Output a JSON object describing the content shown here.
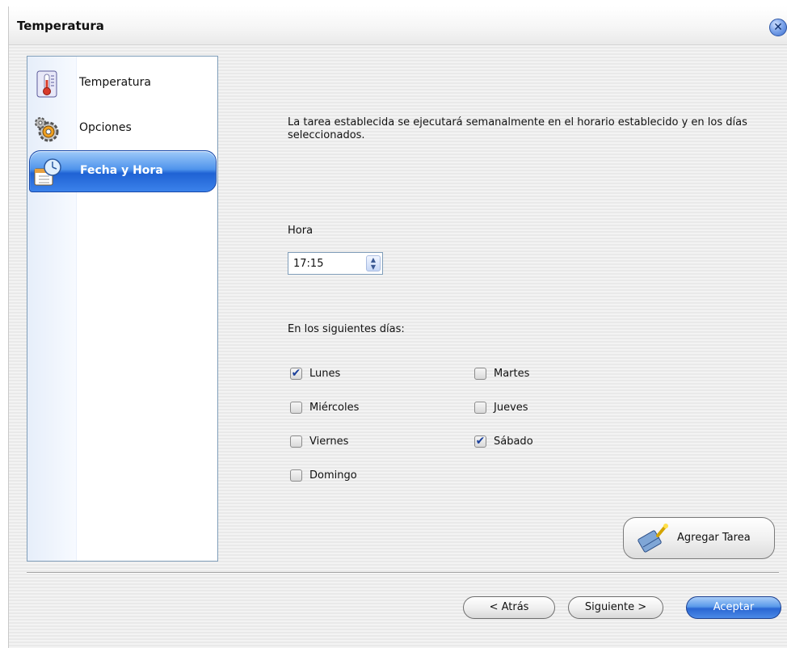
{
  "window": {
    "title": "Temperatura",
    "close_icon": "close-icon"
  },
  "sidebar": {
    "items": [
      {
        "label": "Temperatura",
        "icon": "thermometer-icon",
        "active": false
      },
      {
        "label": "Opciones",
        "icon": "gears-icon",
        "active": false
      },
      {
        "label": "Fecha y Hora",
        "icon": "calendar-clock-icon",
        "active": true
      }
    ]
  },
  "main": {
    "description": "La tarea establecida se ejecutará semanalmente en el horario establecido y en los días seleccionados.",
    "hora_label": "Hora",
    "time_value": "17:15",
    "days_label": "En los siguientes días:",
    "days": [
      {
        "label": "Lunes",
        "checked": true
      },
      {
        "label": "Martes",
        "checked": false
      },
      {
        "label": "Miércoles",
        "checked": false
      },
      {
        "label": "Jueves",
        "checked": false
      },
      {
        "label": "Viernes",
        "checked": false
      },
      {
        "label": "Sábado",
        "checked": true
      },
      {
        "label": "Domingo",
        "checked": false
      }
    ],
    "add_task_label": "Agregar Tarea"
  },
  "footer": {
    "back_label": "< Atrás",
    "next_label": "Siguiente >",
    "accept_label": "Aceptar"
  },
  "colors": {
    "accent": "#2a66d3",
    "sidebar_border": "#7f9db9"
  }
}
